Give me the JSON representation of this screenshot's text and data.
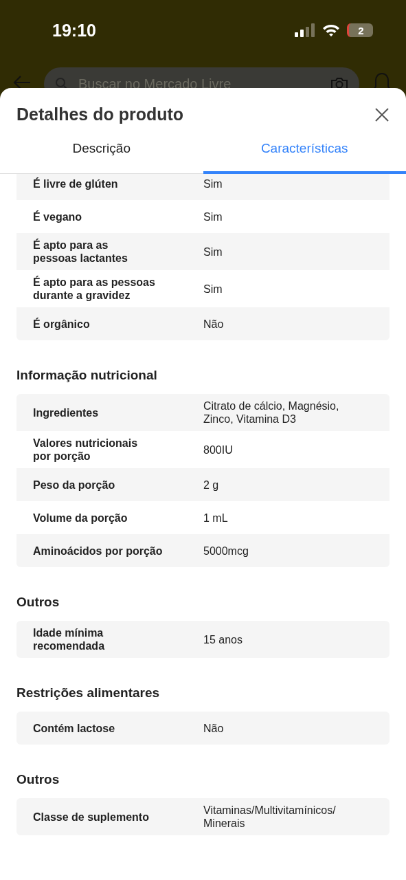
{
  "status_bar": {
    "time": "19:10",
    "battery": "2"
  },
  "background_header": {
    "search": {
      "placeholder": "Buscar no Mercado Livre"
    }
  },
  "sheet": {
    "title": "Detalhes do produto",
    "tabs": [
      {
        "label": "Descrição",
        "selected": false
      },
      {
        "label": "Características",
        "selected": true
      }
    ],
    "sections": [
      {
        "rows": [
          {
            "label": "É livre de glúten",
            "value": "Sim"
          },
          {
            "label": "É vegano",
            "value": "Sim"
          },
          {
            "label": "É apto para as pessoas lactantes",
            "value": "Sim"
          },
          {
            "label": "É apto para as pessoas durante a gravidez",
            "value": "Sim"
          },
          {
            "label": "É orgânico",
            "value": "Não"
          }
        ]
      },
      {
        "title": "Informação nutricional",
        "rows": [
          {
            "label": "Ingredientes",
            "value": "Citrato de cálcio, Magnésio, Zinco, Vitamina D3"
          },
          {
            "label": "Valores nutricionais por porção",
            "value": "800IU"
          },
          {
            "label": "Peso da porção",
            "value": "2 g"
          },
          {
            "label": "Volume da porção",
            "value": "1 mL"
          },
          {
            "label": "Aminoácidos por porção",
            "value": "5000mcg"
          }
        ]
      },
      {
        "title": "Outros",
        "rows": [
          {
            "label": "Idade mínima recomendada",
            "value": "15 anos"
          }
        ]
      },
      {
        "title": "Restrições alimentares",
        "rows": [
          {
            "label": "Contém lactose",
            "value": "Não"
          }
        ]
      },
      {
        "title": "Outros",
        "rows": [
          {
            "label": "Classe de suplemento",
            "value": "Vitaminas/Multivitamínicos/ Minerais"
          }
        ]
      }
    ]
  }
}
